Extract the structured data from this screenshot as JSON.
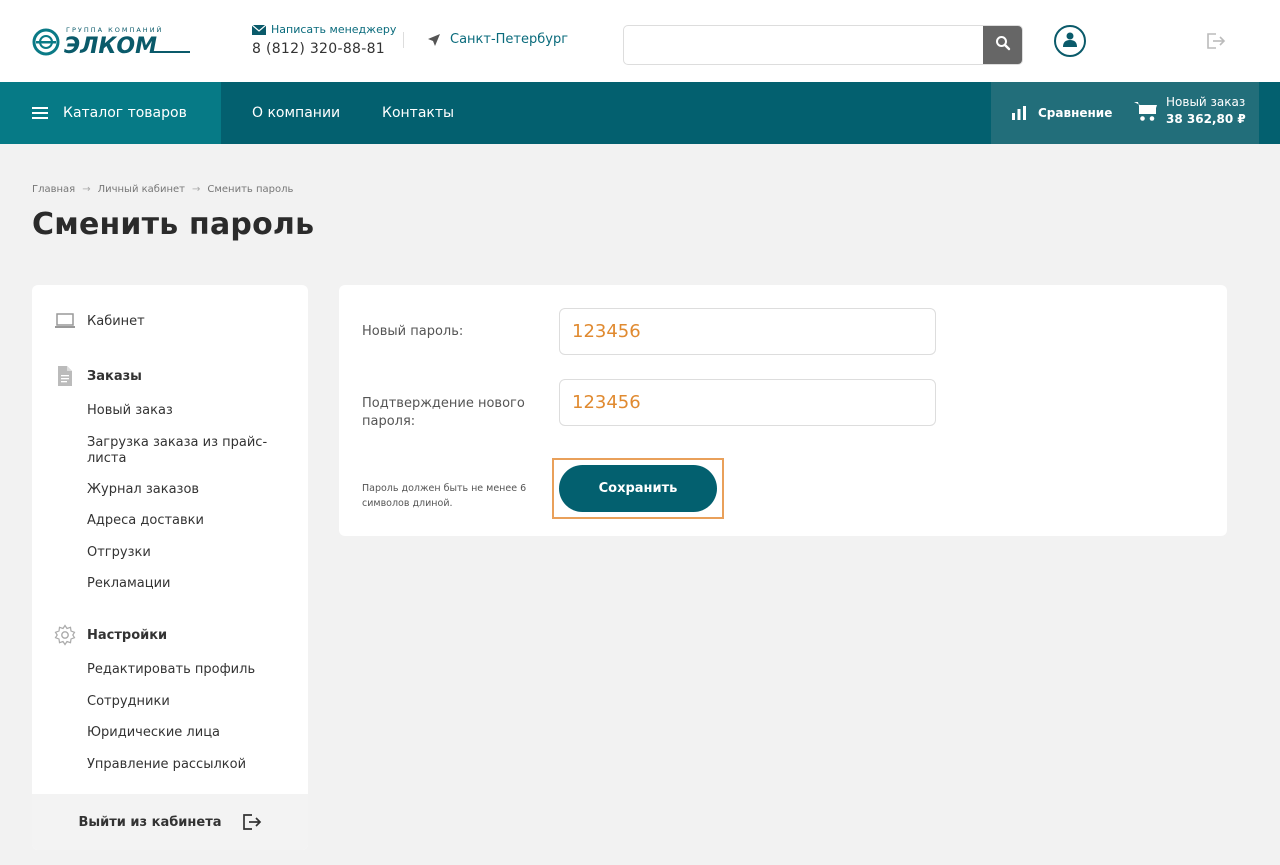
{
  "header": {
    "logo": {
      "top_text": "ГРУППА КОМПАНИЙ",
      "name": "ЭЛКОМ"
    },
    "mail_label": "Написать менеджеру",
    "phone": "8 (812) 320-88-81",
    "city": "Санкт-Петербург",
    "search": {
      "value": "",
      "placeholder": ""
    }
  },
  "nav": {
    "catalog": "Каталог товаров",
    "about": "О компании",
    "contacts": "Контакты",
    "compare": "Сравнение",
    "cart_label": "Новый заказ",
    "cart_sum": "38 362,80 ₽"
  },
  "breadcrumb": [
    "Главная",
    "Личный кабинет",
    "Сменить пароль"
  ],
  "breadcrumb_sep": "→",
  "page_title": "Сменить пароль",
  "sidebar": {
    "cabinet": "Кабинет",
    "orders": {
      "title": "Заказы",
      "items": [
        "Новый заказ",
        "Загрузка заказа из прайс-листа",
        "Журнал заказов",
        "Адреса доставки",
        "Отгрузки",
        "Рекламации"
      ]
    },
    "settings": {
      "title": "Настройки",
      "items": [
        "Редактировать профиль",
        "Сотрудники",
        "Юридические лица",
        "Управление рассылкой"
      ]
    },
    "logout": "Выйти из кабинета"
  },
  "form": {
    "new_password_label": "Новый пароль:",
    "new_password_value": "123456",
    "confirm_label": "Подтверждение нового пароля:",
    "confirm_value": "123456",
    "hint": "Пароль должен быть не менее 6 символов длиной.",
    "save_label": "Сохранить"
  },
  "colors": {
    "nav_bg": "#03606f",
    "catalog_bg": "#067a86",
    "accent_text": "#e08a30",
    "highlight_border": "#e9a05a"
  }
}
